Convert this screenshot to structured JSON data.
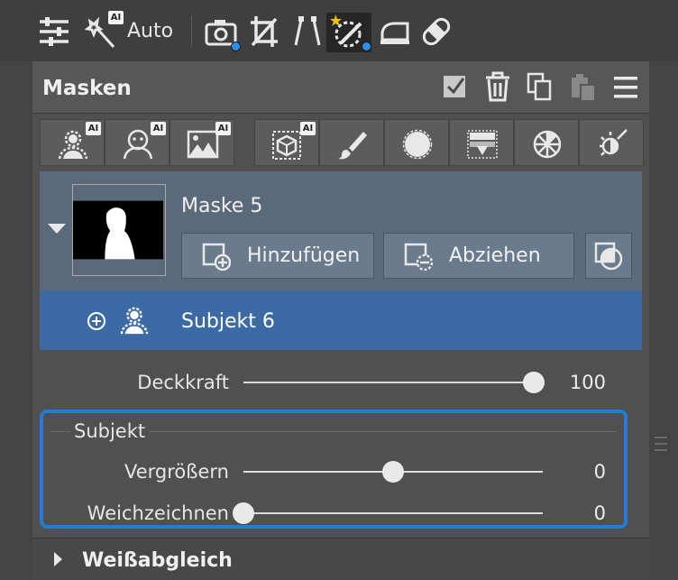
{
  "toolbar": {
    "auto_label": "Auto",
    "ai_badge": "AI",
    "icons": [
      "sliders-icon",
      "magic-wand-icon",
      "camera-icon",
      "crop-icon",
      "perspective-icon",
      "mask-brush-icon",
      "eraser-icon",
      "bandage-icon"
    ]
  },
  "panel": {
    "title": "Masken",
    "header_icons": [
      "checkbox-icon",
      "trash-icon",
      "copy-icon",
      "paste-icon",
      "menu-icon"
    ]
  },
  "mask_tools": {
    "badge": "AI",
    "tools": [
      "subject-ai",
      "portrait-ai",
      "sky-ai",
      "object-ai",
      "brush",
      "radial",
      "gradient",
      "color-range",
      "luminance"
    ]
  },
  "mask": {
    "name": "Maske 5",
    "add_label": "Hinzufügen",
    "subtract_label": "Abziehen"
  },
  "subject_row": {
    "label": "Subjekt 6"
  },
  "opacity": {
    "label": "Deckkraft",
    "value": "100",
    "level": 1.0
  },
  "subject_group": {
    "title": "Subjekt",
    "enlarge_label": "Vergrößern",
    "enlarge_value": "0",
    "enlarge_level": 0.5,
    "soften_label": "Weichzeichnen",
    "soften_value": "0",
    "soften_level": 0.0
  },
  "white_balance": {
    "label": "Weißabgleich"
  },
  "colors": {
    "accent": "#1f7fd6",
    "selected_row": "#3c6aa4",
    "dot": "#2f8ff0"
  }
}
